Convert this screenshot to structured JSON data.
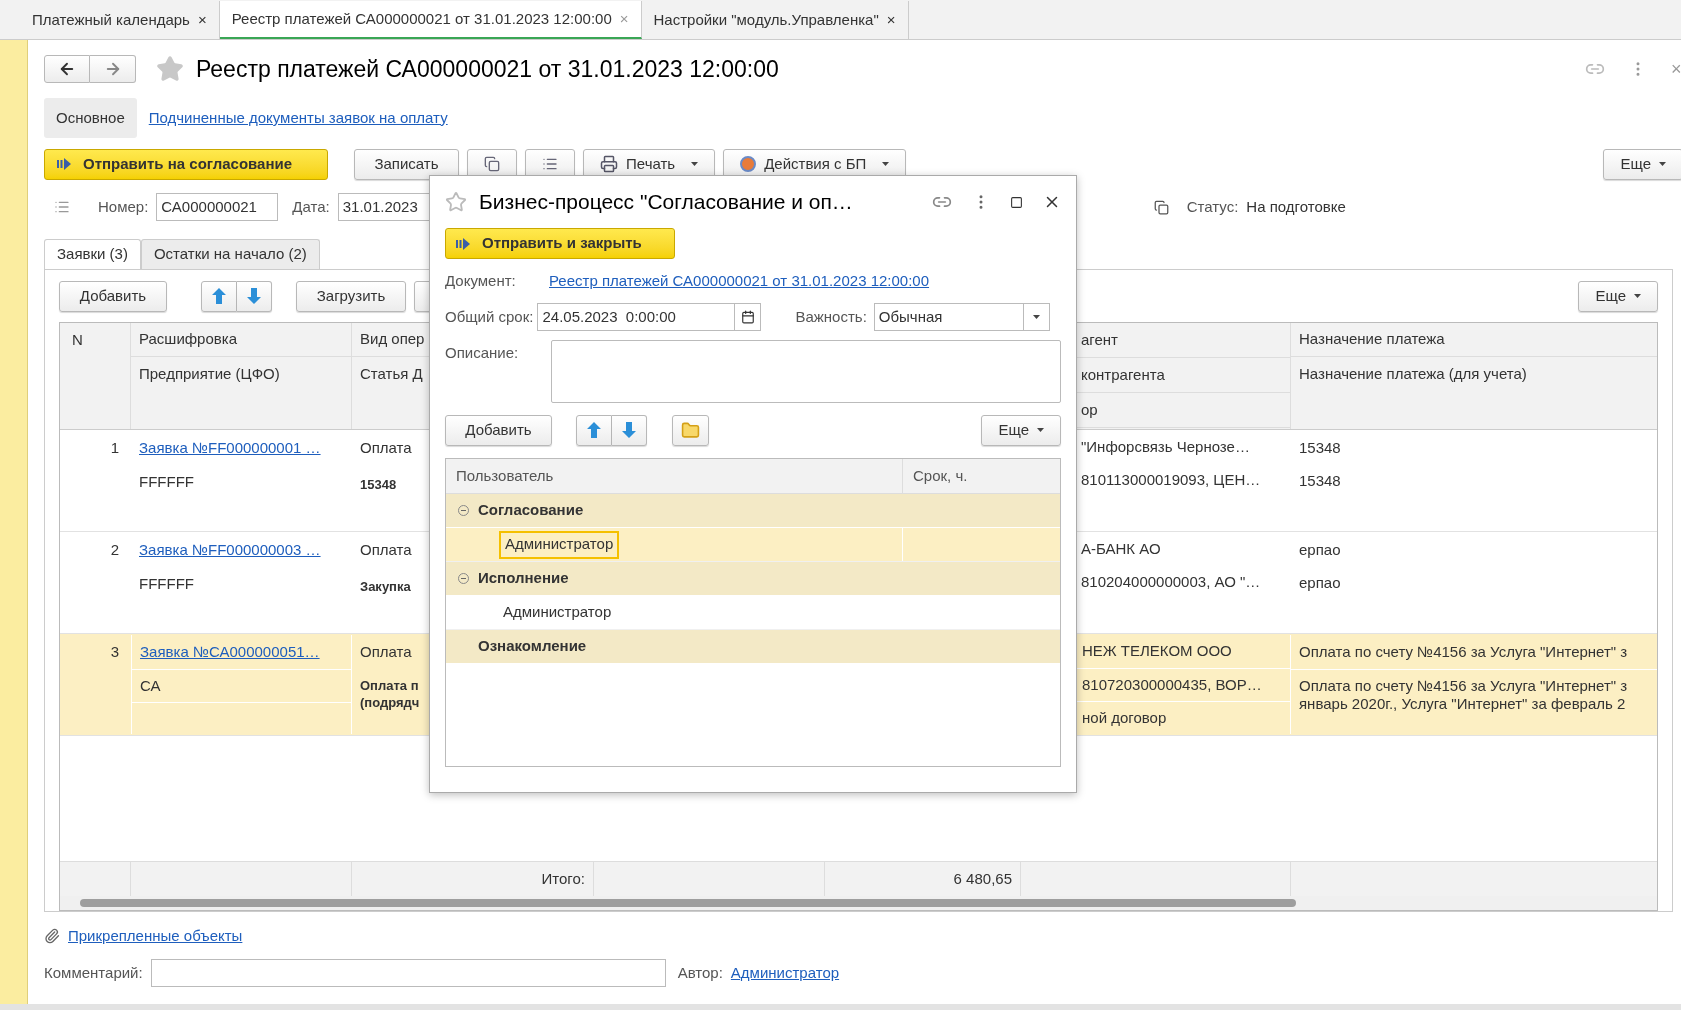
{
  "app_tabs": [
    {
      "label": "Платежный календарь",
      "close": "×",
      "selected": false
    },
    {
      "label": "Реестр платежей СА000000021 от 31.01.2023 12:00:00",
      "close": "×",
      "selected": true
    },
    {
      "label": "Настройки \"модуль.Управленка\"",
      "close": "×",
      "selected": false
    }
  ],
  "form": {
    "title": "Реестр платежей СА000000021 от 31.01.2023 12:00:00",
    "close": "×",
    "sections": [
      {
        "label": "Основное",
        "selected": true
      },
      {
        "label": "Подчиненные документы заявок на оплату",
        "selected": false
      }
    ],
    "toolbar": {
      "primary": "Отправить на согласование",
      "save": "Записать",
      "print": "Печать",
      "bp_actions": "Действия с БП",
      "more": "Еще"
    },
    "number_label": "Номер:",
    "number": "СА000000021",
    "date_label": "Дата:",
    "date": "31.01.2023",
    "status_label": "Статус:",
    "status": "На подготовке"
  },
  "table_tabs": [
    {
      "label": "Заявки (3)",
      "selected": true
    },
    {
      "label": "Остатки на начало (2)",
      "selected": false
    }
  ],
  "table_toolbar": {
    "add": "Добавить",
    "load": "Загрузить",
    "more": "Еще"
  },
  "table": {
    "header": {
      "n": "N",
      "column_2": [
        "Расшифровка",
        "Предприятие (ЦФО)"
      ],
      "column_3": [
        "Вид опер",
        "Статья Д"
      ],
      "column_6": [
        "агент",
        "контрагента",
        "ор"
      ],
      "column_7": [
        "Назначение платежа",
        "Назначение платежа (для учета)"
      ]
    },
    "rows": [
      {
        "n": "1",
        "link": "Заявка №FF000000001 …",
        "cfo": "FFFFFF",
        "operation": "Оплата",
        "article": [
          "15348"
        ],
        "counterparty": [
          "\"Инфорсвязь Чернозе…",
          "810113000019093, ЦЕН…"
        ],
        "purpose": [
          [
            "15348"
          ],
          [
            "15348"
          ]
        ],
        "selected": false
      },
      {
        "n": "2",
        "link": "Заявка №FF000000003 …",
        "cfo": "FFFFFF",
        "operation": "Оплата",
        "article": [
          "Закупка"
        ],
        "counterparty": [
          "А-БАНК АО",
          "810204000000003, АО \"…"
        ],
        "purpose": [
          [
            "ерпао"
          ],
          [
            "ерпао"
          ]
        ],
        "selected": false
      },
      {
        "n": "3",
        "link": "Заявка №СА000000051…",
        "cfo": "СА",
        "operation": "Оплата",
        "article": [
          "Оплата п",
          "(подрядч"
        ],
        "counterparty": [
          "НЕЖ ТЕЛЕКОМ ООО",
          "810720300000435, ВОР…",
          "ной договор"
        ],
        "purpose": [
          [
            "Оплата по счету №4156 за Услуга \"Интернет\" з"
          ],
          [
            "Оплата по счету №4156 за Услуга \"Интернет\" з",
            "январь 2020г., Услуга \"Интернет\" за февраль 2"
          ]
        ],
        "selected": true
      }
    ],
    "footer": {
      "total_label": "Итого:",
      "total": "6 480,65"
    }
  },
  "attachments": "Прикрепленные объекты",
  "comment_label": "Комментарий:",
  "author_label": "Автор:",
  "author": "Администратор",
  "dialog": {
    "title": "Бизнес-процесс \"Согласование и оп…",
    "primary": "Отправить и закрыть",
    "document_label": "Документ:",
    "document": "Реестр платежей СА000000021 от 31.01.2023 12:00:00",
    "term_label": "Общий срок:",
    "term": "24.05.2023  0:00:00",
    "importance_label": "Важность:",
    "importance": "Обычная",
    "description_label": "Описание:",
    "add": "Добавить",
    "more": "Еще",
    "columns": [
      "Пользователь",
      "Срок, ч."
    ],
    "groups": [
      {
        "label": "Согласование",
        "expanded": true,
        "children": [
          {
            "label": "Администратор",
            "selected": true
          }
        ]
      },
      {
        "label": "Исполнение",
        "expanded": true,
        "children": [
          {
            "label": "Администратор",
            "selected": false
          }
        ]
      },
      {
        "label": "Ознакомление"
      }
    ]
  }
}
